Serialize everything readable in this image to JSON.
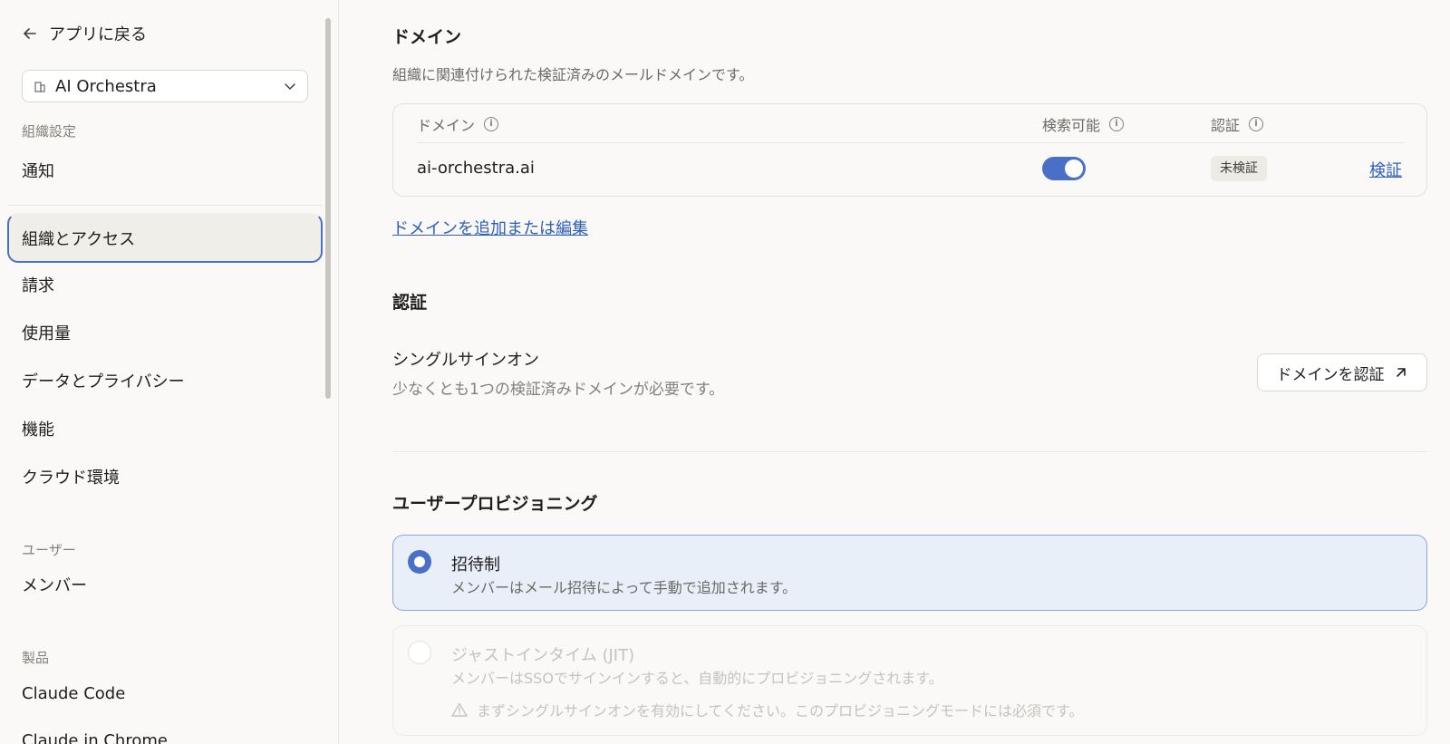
{
  "sidebar": {
    "back_label": "アプリに戻る",
    "org_name": "AI Orchestra",
    "section_org": "組織設定",
    "items_org": [
      "通知",
      "組織とアクセス",
      "請求",
      "使用量",
      "データとプライバシー",
      "機能",
      "クラウド環境"
    ],
    "section_users": "ユーザー",
    "items_users": [
      "メンバー"
    ],
    "section_products": "製品",
    "items_products": [
      "Claude Code",
      "Claude in Chrome"
    ]
  },
  "domain": {
    "title": "ドメイン",
    "subtitle": "組織に関連付けられた検証済みのメールドメインです。",
    "col_domain": "ドメイン",
    "col_searchable": "検索可能",
    "col_auth": "認証",
    "row": {
      "domain": "ai-orchestra.ai",
      "searchable": true,
      "status": "未検証",
      "action": "検証"
    },
    "add_link": "ドメインを追加または編集"
  },
  "auth": {
    "title": "認証",
    "sso_title": "シングルサインオン",
    "sso_desc": "少なくとも1つの検証済みドメインが必要です。",
    "sso_button": "ドメインを認証"
  },
  "provisioning": {
    "title": "ユーザープロビジョニング",
    "options": [
      {
        "title": "招待制",
        "desc": "メンバーはメール招待によって手動で追加されます。",
        "selected": true
      },
      {
        "title": "ジャストインタイム (JIT)",
        "desc": "メンバーはSSOでサインインすると、自動的にプロビジョニングされます。",
        "warning": "まずシングルサインオンを有効にしてください。このプロビジョニングモードには必須です。",
        "selected": false
      }
    ]
  },
  "colors": {
    "accent": "#4a6fc7",
    "link": "#2f5fbf"
  }
}
